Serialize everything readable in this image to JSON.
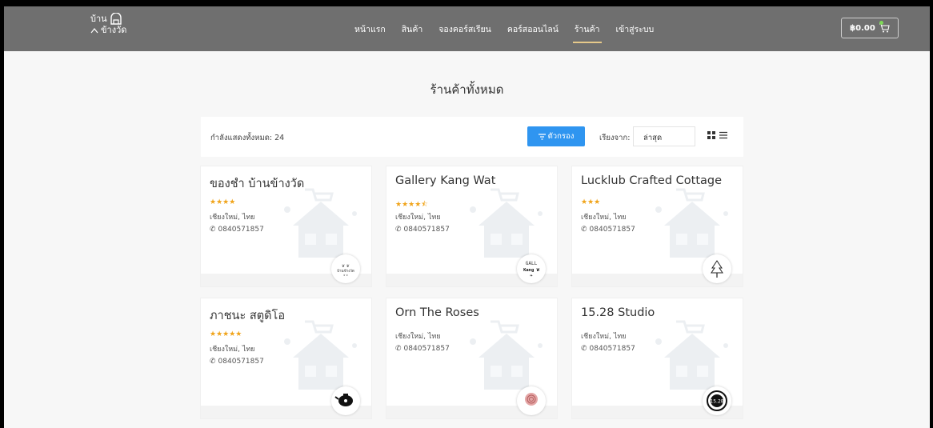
{
  "navbar": {
    "logo_line1": "บ้าน",
    "logo_line2": "ข้างวัด",
    "links": [
      "หน้าแรก",
      "สินค้า",
      "จองคอร์สเรียน",
      "คอร์สออนไลน์",
      "ร้านค้า",
      "เข้าสู่ระบบ"
    ],
    "active_link": "ร้านค้า",
    "cart_total": "฿0.00"
  },
  "page_title": "ร้านค้าทั้งหมด",
  "filter_bar": {
    "count_text": "กำลังแสดงทั้งหมด: 24",
    "filter_button": "ตัวกรอง",
    "sort_label": "เรียงจาก:",
    "sort_value": "ล่าสุด"
  },
  "shops": [
    {
      "name": "ของชำ บ้านข้างวัด",
      "stars": "★★★★",
      "location": "เชียงใหม่, ไทย",
      "phone": "0840571857",
      "avatar_text": "บ้านข้างวัด"
    },
    {
      "name": "Gallery Kang Wat",
      "stars": "★★★★⯪",
      "location": "เชียงใหม่, ไทย",
      "phone": "0840571857",
      "avatar_text": "GALL Kang W"
    },
    {
      "name": "Lucklub Crafted Cottage",
      "stars": "★★★",
      "location": "เชียงใหม่, ไทย",
      "phone": "0840571857",
      "avatar_text": ""
    },
    {
      "name": "ภาชนะ สตูดิโอ",
      "stars": "★★★★★",
      "location": "เชียงใหม่, ไทย",
      "phone": "0840571857",
      "avatar_text": ""
    },
    {
      "name": "Orn The Roses",
      "stars": "",
      "location": "เชียงใหม่, ไทย",
      "phone": "0840571857",
      "avatar_text": ""
    },
    {
      "name": "15.28 Studio",
      "stars": "",
      "location": "เชียงใหม่, ไทย",
      "phone": "0840571857",
      "avatar_text": "15.28"
    }
  ],
  "colors": {
    "navbar": "#6f6f6f",
    "accent": "#2f95f0",
    "star": "#f0a41b",
    "active_underline": "#e6c98a"
  }
}
